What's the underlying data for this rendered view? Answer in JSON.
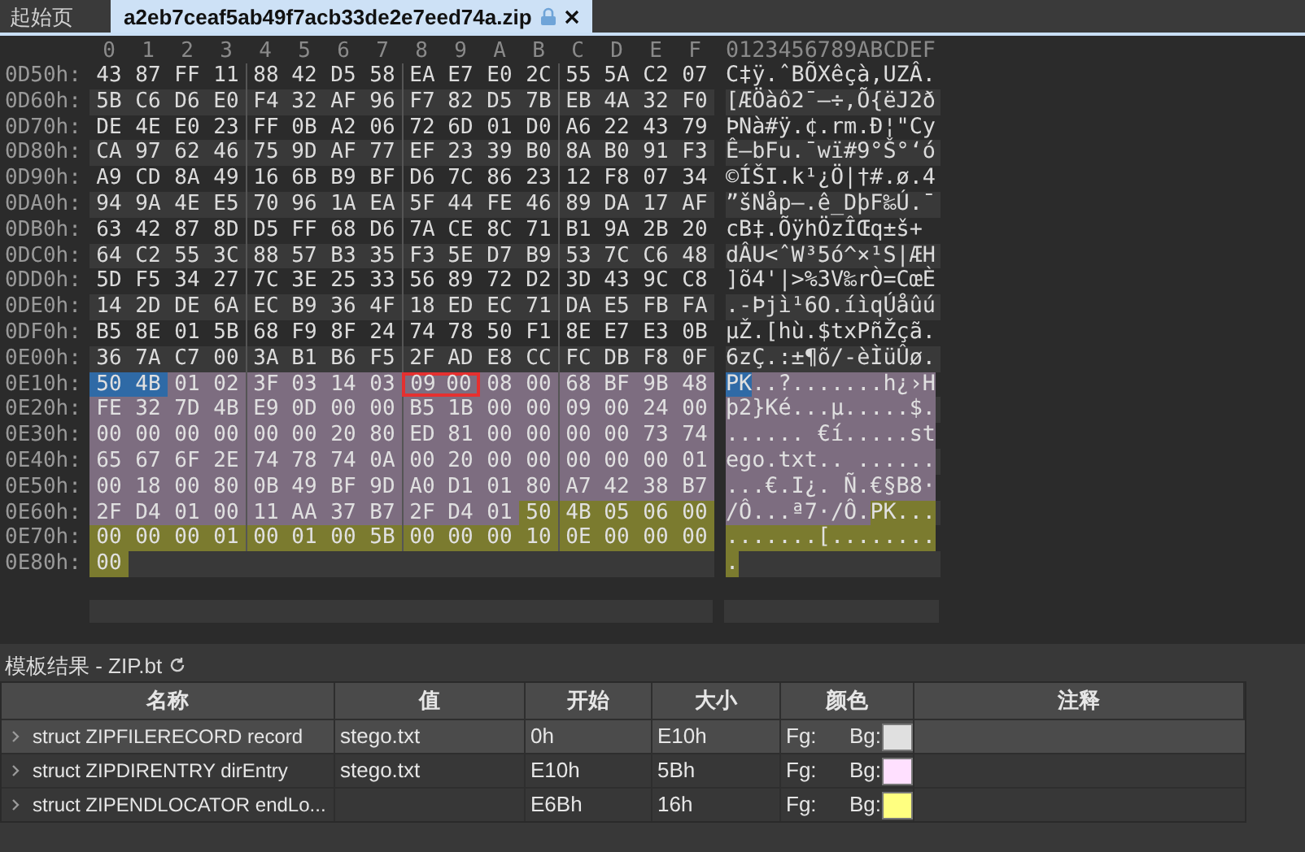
{
  "tabs": [
    {
      "label": "起始页",
      "selected": false
    },
    {
      "label": "a2eb7ceaf5ab49f7acb33de2e7eed74a.zip",
      "selected": true,
      "locked": true
    }
  ],
  "hex_view": {
    "column_headers": [
      "0",
      "1",
      "2",
      "3",
      "4",
      "5",
      "6",
      "7",
      "8",
      "9",
      "A",
      "B",
      "C",
      "D",
      "E",
      "F"
    ],
    "ascii_header": "0123456789ABCDEF",
    "rows": [
      {
        "offset": "0D50h:",
        "bytes": [
          "43",
          "87",
          "FF",
          "11",
          "88",
          "42",
          "D5",
          "58",
          "EA",
          "E7",
          "E0",
          "2C",
          "55",
          "5A",
          "C2",
          "07"
        ],
        "ascii": "C‡ÿ.ˆBÕXêçà,UZÂ."
      },
      {
        "offset": "0D60h:",
        "bytes": [
          "5B",
          "C6",
          "D6",
          "E0",
          "F4",
          "32",
          "AF",
          "96",
          "F7",
          "82",
          "D5",
          "7B",
          "EB",
          "4A",
          "32",
          "F0"
        ],
        "ascii": "[ÆÖàô2¯–÷‚Õ{ëJ2ð"
      },
      {
        "offset": "0D70h:",
        "bytes": [
          "DE",
          "4E",
          "E0",
          "23",
          "FF",
          "0B",
          "A2",
          "06",
          "72",
          "6D",
          "01",
          "D0",
          "A6",
          "22",
          "43",
          "79"
        ],
        "ascii": "ÞNà#ÿ.¢.rm.Ð¦\"Cy"
      },
      {
        "offset": "0D80h:",
        "bytes": [
          "CA",
          "97",
          "62",
          "46",
          "75",
          "9D",
          "AF",
          "77",
          "EF",
          "23",
          "39",
          "B0",
          "8A",
          "B0",
          "91",
          "F3"
        ],
        "ascii": "Ê—bFu.¯wï#9°Š°‘ó"
      },
      {
        "offset": "0D90h:",
        "bytes": [
          "A9",
          "CD",
          "8A",
          "49",
          "16",
          "6B",
          "B9",
          "BF",
          "D6",
          "7C",
          "86",
          "23",
          "12",
          "F8",
          "07",
          "34"
        ],
        "ascii": "©ÍŠI.k¹¿Ö|†#.ø.4"
      },
      {
        "offset": "0DA0h:",
        "bytes": [
          "94",
          "9A",
          "4E",
          "E5",
          "70",
          "96",
          "1A",
          "EA",
          "5F",
          "44",
          "FE",
          "46",
          "89",
          "DA",
          "17",
          "AF"
        ],
        "ascii": "”šNåp–.ê_DþF‰Ú.¯"
      },
      {
        "offset": "0DB0h:",
        "bytes": [
          "63",
          "42",
          "87",
          "8D",
          "D5",
          "FF",
          "68",
          "D6",
          "7A",
          "CE",
          "8C",
          "71",
          "B1",
          "9A",
          "2B",
          "20"
        ],
        "ascii": "cB‡.ÕÿhÖzÎŒq±š+ "
      },
      {
        "offset": "0DC0h:",
        "bytes": [
          "64",
          "C2",
          "55",
          "3C",
          "88",
          "57",
          "B3",
          "35",
          "F3",
          "5E",
          "D7",
          "B9",
          "53",
          "7C",
          "C6",
          "48"
        ],
        "ascii": "dÂU<ˆW³5ó^×¹S|ÆH"
      },
      {
        "offset": "0DD0h:",
        "bytes": [
          "5D",
          "F5",
          "34",
          "27",
          "7C",
          "3E",
          "25",
          "33",
          "56",
          "89",
          "72",
          "D2",
          "3D",
          "43",
          "9C",
          "C8"
        ],
        "ascii": "]õ4'|>%3V‰rÒ=CœÈ"
      },
      {
        "offset": "0DE0h:",
        "bytes": [
          "14",
          "2D",
          "DE",
          "6A",
          "EC",
          "B9",
          "36",
          "4F",
          "18",
          "ED",
          "EC",
          "71",
          "DA",
          "E5",
          "FB",
          "FA"
        ],
        "ascii": ".-Þjì¹6O.íìqÚåûú"
      },
      {
        "offset": "0DF0h:",
        "bytes": [
          "B5",
          "8E",
          "01",
          "5B",
          "68",
          "F9",
          "8F",
          "24",
          "74",
          "78",
          "50",
          "F1",
          "8E",
          "E7",
          "E3",
          "0B"
        ],
        "ascii": "µŽ.[hù.$txPñŽçã."
      },
      {
        "offset": "0E00h:",
        "bytes": [
          "36",
          "7A",
          "C7",
          "00",
          "3A",
          "B1",
          "B6",
          "F5",
          "2F",
          "AD",
          "E8",
          "CC",
          "FC",
          "DB",
          "F8",
          "0F"
        ],
        "ascii": "6zÇ.:±¶õ/-èÌüÛø."
      },
      {
        "offset": "0E10h:",
        "ascii": "PK..?.......h¿›H",
        "cells": [
          {
            "hex": "50",
            "selected": true,
            "outlined": false
          },
          {
            "hex": "4B",
            "selected": true,
            "outlined": false
          },
          {
            "hex": "01",
            "kind": "entry",
            "selected": false,
            "outlined": false
          },
          {
            "hex": "02",
            "kind": "entry",
            "selected": false,
            "outlined": false
          },
          {
            "hex": "3F",
            "kind": "entry",
            "selected": false,
            "outlined": false
          },
          {
            "hex": "03",
            "kind": "entry",
            "selected": false,
            "outlined": false
          },
          {
            "hex": "14",
            "kind": "entry",
            "selected": false,
            "outlined": false
          },
          {
            "hex": "03",
            "kind": "entry",
            "selected": false,
            "outlined": false
          },
          {
            "hex": "09",
            "kind": "entry",
            "selected": false,
            "outlined": true
          },
          {
            "hex": "00",
            "kind": "entry",
            "selected": false,
            "outlined": true
          },
          {
            "hex": "08",
            "kind": "entry",
            "selected": false,
            "outlined": false
          },
          {
            "hex": "00",
            "kind": "entry",
            "selected": false,
            "outlined": false
          },
          {
            "hex": "68",
            "kind": "entry",
            "selected": false,
            "outlined": false
          },
          {
            "hex": "BF",
            "kind": "entry",
            "selected": false,
            "outlined": false
          },
          {
            "hex": "9B",
            "kind": "entry",
            "selected": false,
            "outlined": false
          },
          {
            "hex": "48",
            "kind": "entry",
            "selected": false,
            "outlined": false
          }
        ]
      },
      {
        "offset": "0E20h:",
        "ascii": "þ2}Ké...µ.....$.",
        "cells": [
          {
            "hex": "FE",
            "kind": "entry",
            "selected": false,
            "outlined": false
          },
          {
            "hex": "32",
            "kind": "entry",
            "selected": false,
            "outlined": false
          },
          {
            "hex": "7D",
            "kind": "entry",
            "selected": false,
            "outlined": false
          },
          {
            "hex": "4B",
            "kind": "entry",
            "selected": false,
            "outlined": false
          },
          {
            "hex": "E9",
            "kind": "entry",
            "selected": false,
            "outlined": false
          },
          {
            "hex": "0D",
            "kind": "entry",
            "selected": false,
            "outlined": false
          },
          {
            "hex": "00",
            "kind": "entry",
            "selected": false,
            "outlined": false
          },
          {
            "hex": "00",
            "kind": "entry",
            "selected": false,
            "outlined": false
          },
          {
            "hex": "B5",
            "kind": "entry",
            "selected": false,
            "outlined": false
          },
          {
            "hex": "1B",
            "kind": "entry",
            "selected": false,
            "outlined": false
          },
          {
            "hex": "00",
            "kind": "entry",
            "selected": false,
            "outlined": false
          },
          {
            "hex": "00",
            "kind": "entry",
            "selected": false,
            "outlined": false
          },
          {
            "hex": "09",
            "kind": "entry",
            "selected": false,
            "outlined": false
          },
          {
            "hex": "00",
            "kind": "entry",
            "selected": false,
            "outlined": false
          },
          {
            "hex": "24",
            "kind": "entry",
            "selected": false,
            "outlined": false
          },
          {
            "hex": "00",
            "kind": "entry",
            "selected": false,
            "outlined": false
          }
        ]
      },
      {
        "offset": "0E30h:",
        "ascii": "...... €í.....st",
        "cells": [
          {
            "hex": "00",
            "kind": "entry",
            "selected": false,
            "outlined": false
          },
          {
            "hex": "00",
            "kind": "entry",
            "selected": false,
            "outlined": false
          },
          {
            "hex": "00",
            "kind": "entry",
            "selected": false,
            "outlined": false
          },
          {
            "hex": "00",
            "kind": "entry",
            "selected": false,
            "outlined": false
          },
          {
            "hex": "00",
            "kind": "entry",
            "selected": false,
            "outlined": false
          },
          {
            "hex": "00",
            "kind": "entry",
            "selected": false,
            "outlined": false
          },
          {
            "hex": "20",
            "kind": "entry",
            "selected": false,
            "outlined": false
          },
          {
            "hex": "80",
            "kind": "entry",
            "selected": false,
            "outlined": false
          },
          {
            "hex": "ED",
            "kind": "entry",
            "selected": false,
            "outlined": false
          },
          {
            "hex": "81",
            "kind": "entry",
            "selected": false,
            "outlined": false
          },
          {
            "hex": "00",
            "kind": "entry",
            "selected": false,
            "outlined": false
          },
          {
            "hex": "00",
            "kind": "entry",
            "selected": false,
            "outlined": false
          },
          {
            "hex": "00",
            "kind": "entry",
            "selected": false,
            "outlined": false
          },
          {
            "hex": "00",
            "kind": "entry",
            "selected": false,
            "outlined": false
          },
          {
            "hex": "73",
            "kind": "entry",
            "selected": false,
            "outlined": false
          },
          {
            "hex": "74",
            "kind": "entry",
            "selected": false,
            "outlined": false
          }
        ]
      },
      {
        "offset": "0E40h:",
        "ascii": "ego.txt.. ......",
        "cells": [
          {
            "hex": "65",
            "kind": "entry",
            "selected": false,
            "outlined": false
          },
          {
            "hex": "67",
            "kind": "entry",
            "selected": false,
            "outlined": false
          },
          {
            "hex": "6F",
            "kind": "entry",
            "selected": false,
            "outlined": false
          },
          {
            "hex": "2E",
            "kind": "entry",
            "selected": false,
            "outlined": false
          },
          {
            "hex": "74",
            "kind": "entry",
            "selected": false,
            "outlined": false
          },
          {
            "hex": "78",
            "kind": "entry",
            "selected": false,
            "outlined": false
          },
          {
            "hex": "74",
            "kind": "entry",
            "selected": false,
            "outlined": false
          },
          {
            "hex": "0A",
            "kind": "entry",
            "selected": false,
            "outlined": false
          },
          {
            "hex": "00",
            "kind": "entry",
            "selected": false,
            "outlined": false
          },
          {
            "hex": "20",
            "kind": "entry",
            "selected": false,
            "outlined": false
          },
          {
            "hex": "00",
            "kind": "entry",
            "selected": false,
            "outlined": false
          },
          {
            "hex": "00",
            "kind": "entry",
            "selected": false,
            "outlined": false
          },
          {
            "hex": "00",
            "kind": "entry",
            "selected": false,
            "outlined": false
          },
          {
            "hex": "00",
            "kind": "entry",
            "selected": false,
            "outlined": false
          },
          {
            "hex": "00",
            "kind": "entry",
            "selected": false,
            "outlined": false
          },
          {
            "hex": "01",
            "kind": "entry",
            "selected": false,
            "outlined": false
          }
        ]
      },
      {
        "offset": "0E50h:",
        "ascii": "...€.I¿. Ñ.€§B8·",
        "cells": [
          {
            "hex": "00",
            "kind": "entry",
            "selected": false,
            "outlined": false
          },
          {
            "hex": "18",
            "kind": "entry",
            "selected": false,
            "outlined": false
          },
          {
            "hex": "00",
            "kind": "entry",
            "selected": false,
            "outlined": false
          },
          {
            "hex": "80",
            "kind": "entry",
            "selected": false,
            "outlined": false
          },
          {
            "hex": "0B",
            "kind": "entry",
            "selected": false,
            "outlined": false
          },
          {
            "hex": "49",
            "kind": "entry",
            "selected": false,
            "outlined": false
          },
          {
            "hex": "BF",
            "kind": "entry",
            "selected": false,
            "outlined": false
          },
          {
            "hex": "9D",
            "kind": "entry",
            "selected": false,
            "outlined": false
          },
          {
            "hex": "A0",
            "kind": "entry",
            "selected": false,
            "outlined": false
          },
          {
            "hex": "D1",
            "kind": "entry",
            "selected": false,
            "outlined": false
          },
          {
            "hex": "01",
            "kind": "entry",
            "selected": false,
            "outlined": false
          },
          {
            "hex": "80",
            "kind": "entry",
            "selected": false,
            "outlined": false
          },
          {
            "hex": "A7",
            "kind": "entry",
            "selected": false,
            "outlined": false
          },
          {
            "hex": "42",
            "kind": "entry",
            "selected": false,
            "outlined": false
          },
          {
            "hex": "38",
            "kind": "entry",
            "selected": false,
            "outlined": false
          },
          {
            "hex": "B7",
            "kind": "entry",
            "selected": false,
            "outlined": false
          }
        ]
      },
      {
        "offset": "0E60h:",
        "ascii": "/Ô...ª7·/Ô.PK...",
        "cells": [
          {
            "hex": "2F",
            "kind": "entry",
            "selected": false,
            "outlined": false
          },
          {
            "hex": "D4",
            "kind": "entry",
            "selected": false,
            "outlined": false
          },
          {
            "hex": "01",
            "kind": "entry",
            "selected": false,
            "outlined": false
          },
          {
            "hex": "00",
            "kind": "entry",
            "selected": false,
            "outlined": false
          },
          {
            "hex": "11",
            "kind": "entry",
            "selected": false,
            "outlined": false
          },
          {
            "hex": "AA",
            "kind": "entry",
            "selected": false,
            "outlined": false
          },
          {
            "hex": "37",
            "kind": "entry",
            "selected": false,
            "outlined": false
          },
          {
            "hex": "B7",
            "kind": "entry",
            "selected": false,
            "outlined": false
          },
          {
            "hex": "2F",
            "kind": "entry",
            "selected": false,
            "outlined": false
          },
          {
            "hex": "D4",
            "kind": "entry",
            "selected": false,
            "outlined": false
          },
          {
            "hex": "01",
            "kind": "entry",
            "selected": false,
            "outlined": false
          },
          {
            "hex": "50",
            "kind": "end",
            "selected": false,
            "outlined": false
          },
          {
            "hex": "4B",
            "kind": "end",
            "selected": false,
            "outlined": false
          },
          {
            "hex": "05",
            "kind": "end",
            "selected": false,
            "outlined": false
          },
          {
            "hex": "06",
            "kind": "end",
            "selected": false,
            "outlined": false
          },
          {
            "hex": "00",
            "kind": "end",
            "selected": false,
            "outlined": false
          }
        ]
      },
      {
        "offset": "0E70h:",
        "ascii": ".......[........",
        "cells": [
          {
            "hex": "00",
            "kind": "end",
            "selected": false,
            "outlined": false
          },
          {
            "hex": "00",
            "kind": "end",
            "selected": false,
            "outlined": false
          },
          {
            "hex": "00",
            "kind": "end",
            "selected": false,
            "outlined": false
          },
          {
            "hex": "01",
            "kind": "end",
            "selected": false,
            "outlined": false
          },
          {
            "hex": "00",
            "kind": "end",
            "selected": false,
            "outlined": false
          },
          {
            "hex": "01",
            "kind": "end",
            "selected": false,
            "outlined": false
          },
          {
            "hex": "00",
            "kind": "end",
            "selected": false,
            "outlined": false
          },
          {
            "hex": "5B",
            "kind": "end",
            "selected": false,
            "outlined": false
          },
          {
            "hex": "00",
            "kind": "end",
            "selected": false,
            "outlined": false
          },
          {
            "hex": "00",
            "kind": "end",
            "selected": false,
            "outlined": false
          },
          {
            "hex": "00",
            "kind": "end",
            "selected": false,
            "outlined": false
          },
          {
            "hex": "10",
            "kind": "end",
            "selected": false,
            "outlined": false
          },
          {
            "hex": "0E",
            "kind": "end",
            "selected": false,
            "outlined": false
          },
          {
            "hex": "00",
            "kind": "end",
            "selected": false,
            "outlined": false
          },
          {
            "hex": "00",
            "kind": "end",
            "selected": false,
            "outlined": false
          },
          {
            "hex": "00",
            "kind": "end",
            "selected": false,
            "outlined": false
          }
        ]
      },
      {
        "offset": "0E80h:",
        "ascii": ".",
        "cells": [
          {
            "hex": "00",
            "kind": "end",
            "selected": false,
            "outlined": false
          }
        ]
      }
    ]
  },
  "template_results": {
    "title": "模板结果 - ZIP.bt",
    "columns": [
      "名称",
      "值",
      "开始",
      "大小",
      "颜色",
      "注释"
    ],
    "rows": [
      {
        "name": "struct ZIPFILERECORD record",
        "value": "stego.txt",
        "start": "0h",
        "size": "E10h",
        "fg_label": "Fg:",
        "bg_label": "Bg:",
        "color": "#e0e0e0",
        "selected": true
      },
      {
        "name": "struct ZIPDIRENTRY dirEntry",
        "value": "stego.txt",
        "start": "E10h",
        "size": "5Bh",
        "fg_label": "Fg:",
        "bg_label": "Bg:",
        "color": "#ffe0ff",
        "selected": false
      },
      {
        "name": "struct ZIPENDLOCATOR endLo...",
        "start": "E6Bh",
        "size": "16h",
        "fg_label": "Fg:",
        "bg_label": "Bg:",
        "color": "#ffff80",
        "selected": false
      }
    ]
  }
}
